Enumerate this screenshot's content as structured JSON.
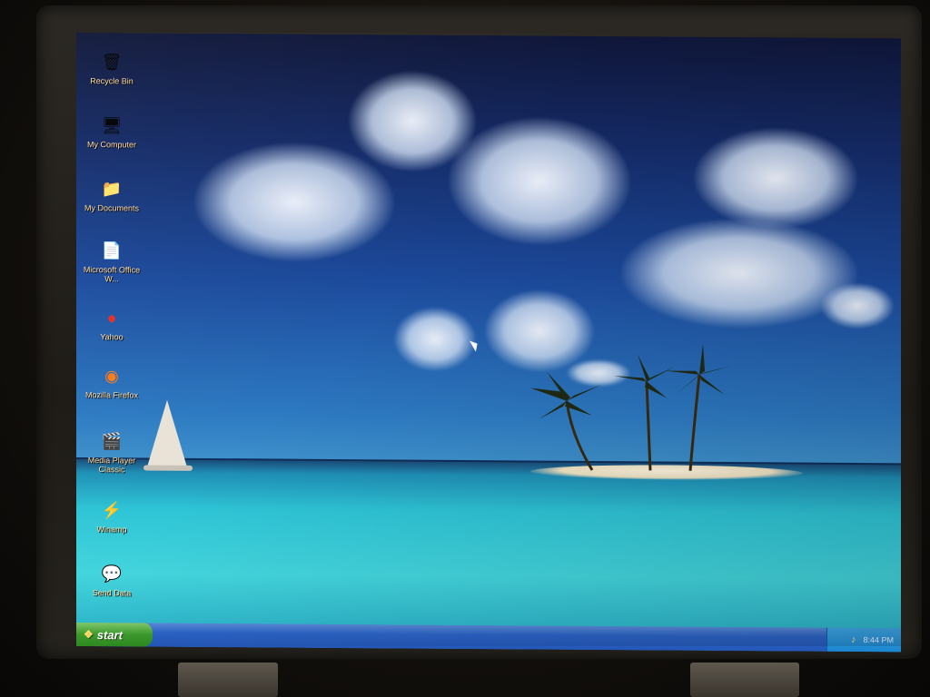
{
  "desktop": {
    "icons": [
      {
        "label": "Recycle Bin",
        "icon": "recycle-bin-icon",
        "glyph": "🗑"
      },
      {
        "label": "My Computer",
        "icon": "computer-icon",
        "glyph": "🖥"
      },
      {
        "label": "My Documents",
        "icon": "folder-icon",
        "glyph": "📁"
      },
      {
        "label": "Microsoft Office W...",
        "icon": "word-document-icon",
        "glyph": "📄"
      },
      {
        "label": "Yahoo",
        "icon": "yahoo-icon",
        "glyph": "●"
      },
      {
        "label": "Mozilla Firefox",
        "icon": "firefox-icon",
        "glyph": "◉"
      },
      {
        "label": "Media Player Classic",
        "icon": "media-player-icon",
        "glyph": "🎬"
      },
      {
        "label": "Winamp",
        "icon": "winamp-icon",
        "glyph": "⚡"
      },
      {
        "label": "Send Data",
        "icon": "speech-bubble-icon",
        "glyph": "💬"
      }
    ]
  },
  "taskbar": {
    "start_label": "start",
    "clock": "8:44 PM"
  },
  "colors": {
    "icon_label": "#ffd9a0",
    "taskbar": "#2457b8",
    "start_button": "#3c9a2c",
    "tray": "#1a86d0"
  }
}
